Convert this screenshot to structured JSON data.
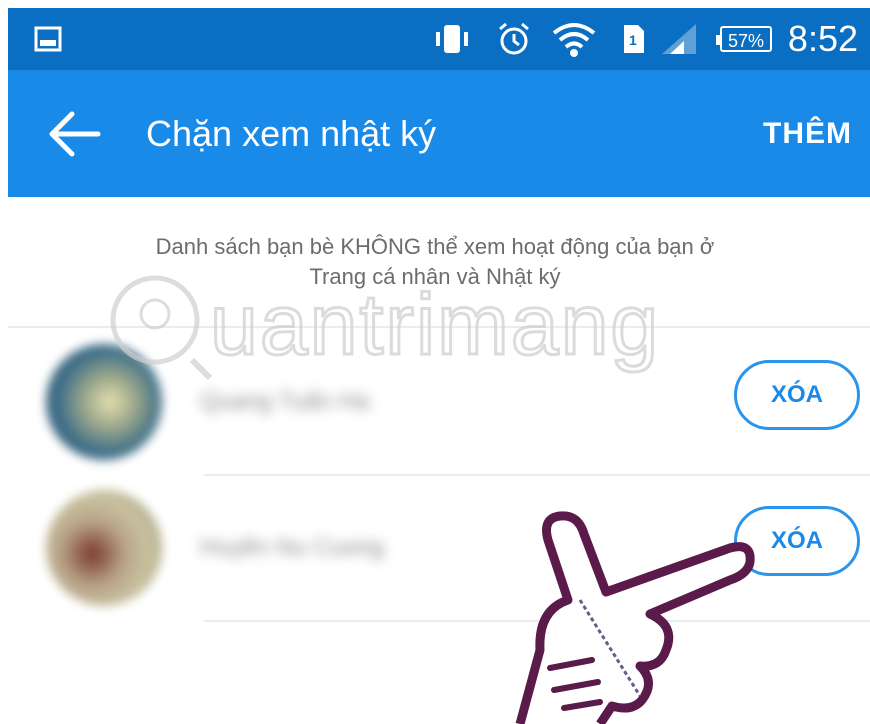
{
  "status_bar": {
    "time": "8:52",
    "battery": "57%",
    "icons": [
      "image-icon",
      "vibrate-icon",
      "alarm-icon",
      "wifi-icon",
      "sim-icon",
      "signal-icon",
      "battery-icon"
    ],
    "color": "#0a6fc2"
  },
  "app_bar": {
    "title": "Chặn xem nhật ký",
    "action_label": "THÊM",
    "back_icon": "arrow-left-icon",
    "color": "#1a8ae8"
  },
  "info_text": {
    "line1": "Danh sách bạn bè KHÔNG thể xem hoạt động của bạn ở",
    "line2": "Trang cá nhân và Nhật ký"
  },
  "blocked_list": [
    {
      "name": "Quang Tuấn Ha",
      "button_label": "XÓA"
    },
    {
      "name": "Huyền Nu Cuong",
      "button_label": "XÓA"
    }
  ],
  "watermark": {
    "text": "uantrimang"
  },
  "accent_color": "#1a8ae8"
}
